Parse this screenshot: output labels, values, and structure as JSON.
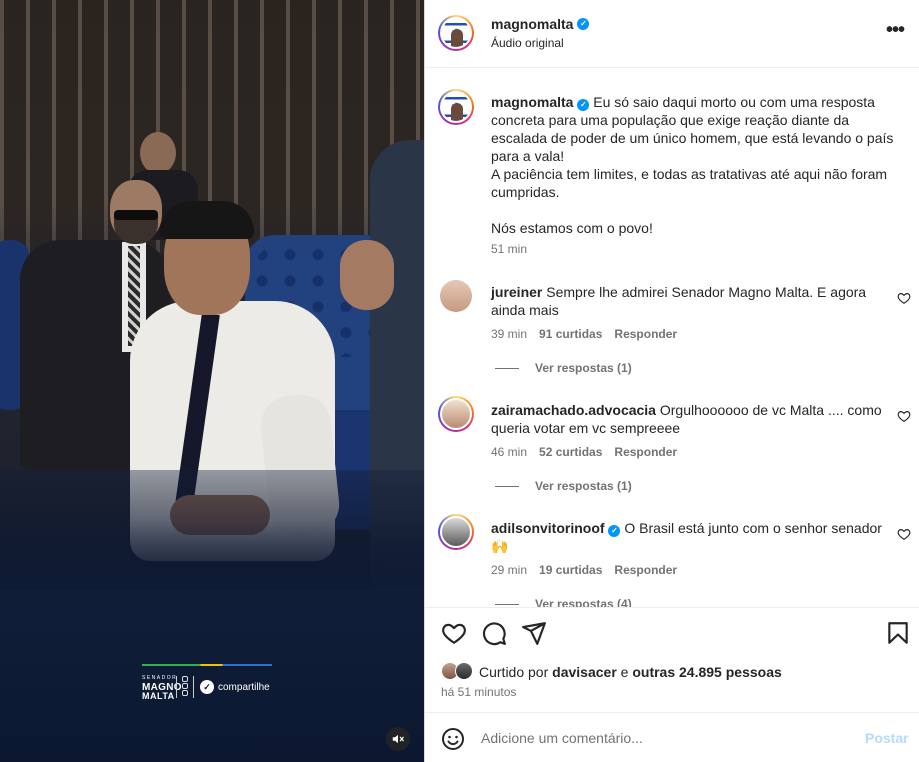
{
  "post": {
    "username": "magnomalta",
    "audio_label": "Áudio original"
  },
  "media": {
    "watermark": {
      "top": "SENADOR",
      "name_line1": "MAGNO",
      "name_line2": "MALTA",
      "share_label": "compartilhe"
    },
    "mute_icon": "speaker-muted-icon"
  },
  "caption": {
    "username": "magnomalta",
    "text": "Eu só saio daqui morto ou com uma resposta concreta para uma população que exige reação diante da escalada de poder de um único homem, que está levando o país para a vala!\nA paciência tem limites, e todas as tratativas até aqui não foram cumpridas.\n\nNós estamos com o povo!",
    "time": "51 min"
  },
  "comments": [
    {
      "username": "jureiner",
      "verified": false,
      "text": "Sempre lhe admirei Senador Magno Malta. E agora ainda mais",
      "time": "39 min",
      "likes": "91 curtidas",
      "reply_label": "Responder",
      "view_replies": "Ver respostas (1)"
    },
    {
      "username": "zairamachado.advocacia",
      "verified": false,
      "text": "Orgulhoooooo de vc Malta .... como queria votar em vc sempreeee",
      "time": "46 min",
      "likes": "52 curtidas",
      "reply_label": "Responder",
      "view_replies": "Ver respostas (1)"
    },
    {
      "username": "adilsonvitorinoof",
      "verified": true,
      "text": "O Brasil está junto com o senhor senador 🙌",
      "time": "29 min",
      "likes": "19 curtidas",
      "reply_label": "Responder",
      "view_replies": "Ver respostas (4)"
    }
  ],
  "likes": {
    "prefix": "Curtido por",
    "user": "davisacer",
    "connector": "e",
    "others": "outras 24.895 pessoas",
    "ago": "há 51 minutos"
  },
  "add_comment": {
    "placeholder": "Adicione um comentário...",
    "post_label": "Postar"
  },
  "colors": {
    "verified": "#0095f6",
    "post_disabled": "#b3dbff",
    "secondary_text": "#737373"
  },
  "icons": [
    "heart-icon",
    "comment-icon",
    "share-icon",
    "bookmark-icon",
    "emoji-icon",
    "more-options-icon",
    "verified-badge-icon",
    "speaker-muted-icon"
  ]
}
